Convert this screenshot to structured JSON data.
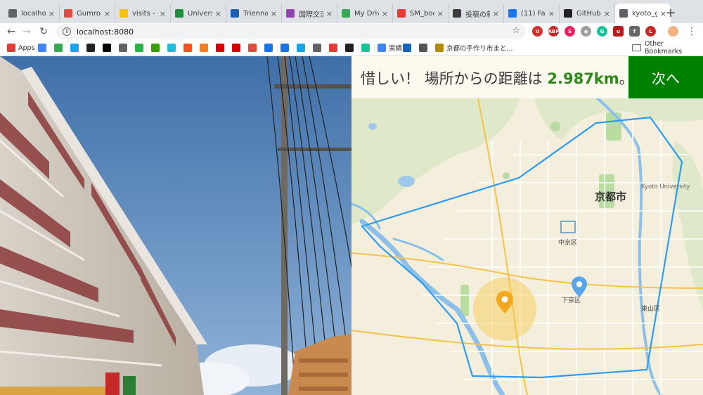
{
  "browser": {
    "tabs": [
      {
        "title": "localho",
        "icon": "globe-icon",
        "color": "#5f6368"
      },
      {
        "title": "Gumroa",
        "icon": "gumroad-icon",
        "color": "#e04b3f"
      },
      {
        "title": "visits -",
        "icon": "visits-icon",
        "color": "#f4c20d"
      },
      {
        "title": "Univers",
        "icon": "univers-icon",
        "color": "#1e8e3e"
      },
      {
        "title": "Trienna",
        "icon": "triennale-icon",
        "color": "#1a5fb4"
      },
      {
        "title": "国際交流",
        "icon": "kokusai-icon",
        "color": "#8e44ad"
      },
      {
        "title": "My Driv",
        "icon": "drive-icon",
        "color": "#34a853"
      },
      {
        "title": "SM_boo",
        "icon": "pdf-icon",
        "color": "#e53935"
      },
      {
        "title": "投稿の新",
        "icon": "wordpress-icon",
        "color": "#3c3c3c"
      },
      {
        "title": "(11) Fac",
        "icon": "facebook-icon",
        "color": "#1877f2"
      },
      {
        "title": "GitHub",
        "icon": "github-icon",
        "color": "#222222"
      },
      {
        "title": "kyoto_g",
        "icon": "globe-icon",
        "color": "#5f6368"
      }
    ],
    "active_tab": 11,
    "url": "localhost:8080",
    "bookmarks": [
      {
        "label": "Apps",
        "icon": "apps-grid-icon",
        "color": "#e53935"
      },
      {
        "label": "",
        "icon": "translate-icon",
        "color": "#4285f4"
      },
      {
        "label": "",
        "icon": "drive-icon",
        "color": "#34a853"
      },
      {
        "label": "",
        "icon": "twitter-icon",
        "color": "#1da1f2"
      },
      {
        "label": "",
        "icon": "github-icon",
        "color": "#222222"
      },
      {
        "label": "",
        "icon": "wikipedia-icon",
        "color": "#000000"
      },
      {
        "label": "",
        "icon": "globe-icon",
        "color": "#5f6368"
      },
      {
        "label": "",
        "icon": "feedly-icon",
        "color": "#2bb24c"
      },
      {
        "label": "",
        "icon": "upwork-icon",
        "color": "#37a000"
      },
      {
        "label": "",
        "icon": "wantedly-icon",
        "color": "#21bddb"
      },
      {
        "label": "",
        "icon": "bookmark-icon",
        "color": "#f4511e"
      },
      {
        "label": "",
        "icon": "stack-icon",
        "color": "#f48024"
      },
      {
        "label": "",
        "icon": "mufg-icon",
        "color": "#d50000"
      },
      {
        "label": "",
        "icon": "mufg-icon",
        "color": "#d50000"
      },
      {
        "label": "",
        "icon": "gumroad-icon",
        "color": "#e04b3f"
      },
      {
        "label": "",
        "icon": "globe-icon",
        "color": "#1a73e8"
      },
      {
        "label": "",
        "icon": "pin-icon",
        "color": "#1a73e8"
      },
      {
        "label": "",
        "icon": "seven-icon",
        "color": "#1aa3e8"
      },
      {
        "label": "",
        "icon": "globe-icon",
        "color": "#5f6368"
      },
      {
        "label": "",
        "icon": "map-pin-icon",
        "color": "#e53935"
      },
      {
        "label": "",
        "icon": "w-icon",
        "color": "#222222"
      },
      {
        "label": "",
        "icon": "grammarly-icon",
        "color": "#15c39a"
      },
      {
        "label": "実績",
        "icon": "docs-icon",
        "color": "#4285f4"
      },
      {
        "label": "",
        "icon": "arrow-icon",
        "color": "#1565c0"
      },
      {
        "label": "",
        "icon": "card-icon",
        "color": "#555555"
      },
      {
        "label": "京都の手作り市まと...",
        "icon": "leaf-icon",
        "color": "#b58900"
      }
    ],
    "other_bookmarks": "Other Bookmarks"
  },
  "game": {
    "result_prefix": "惜しい！ 場所からの距離は",
    "distance": "2.987km",
    "result_suffix": "。",
    "next_label": "次へ"
  },
  "map": {
    "labels": {
      "city": "京都市",
      "university": "Kyoto University",
      "nakagyo": "中京区",
      "shimogyo": "下京区",
      "higashiyama": "東山区"
    },
    "colors": {
      "boundary": "#2c9cf0",
      "guess_pin": "#f4a81d",
      "answer_pin": "#5aa5e8",
      "accent": "#008000"
    }
  }
}
